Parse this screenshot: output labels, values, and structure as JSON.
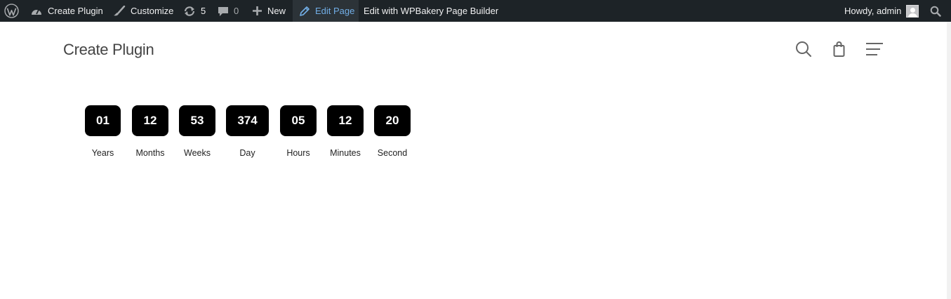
{
  "adminbar": {
    "wp_logo_icon": "wordpress-logo-icon",
    "site_name": "Create Plugin",
    "customize": "Customize",
    "updates_count": "5",
    "comments_count": "0",
    "new_label": "New",
    "edit_page": "Edit Page",
    "wpbakery": "Edit with WPBakery Page Builder",
    "howdy": "Howdy, admin"
  },
  "header": {
    "site_title": "Create Plugin",
    "icons": [
      "search-icon",
      "shopping-bag-icon",
      "menu-icon"
    ]
  },
  "countdown": [
    {
      "value": "01",
      "label": "Years"
    },
    {
      "value": "12",
      "label": "Months"
    },
    {
      "value": "53",
      "label": "Weeks"
    },
    {
      "value": "374",
      "label": "Day"
    },
    {
      "value": "05",
      "label": "Hours"
    },
    {
      "value": "12",
      "label": "Minutes"
    },
    {
      "value": "20",
      "label": "Second"
    }
  ]
}
